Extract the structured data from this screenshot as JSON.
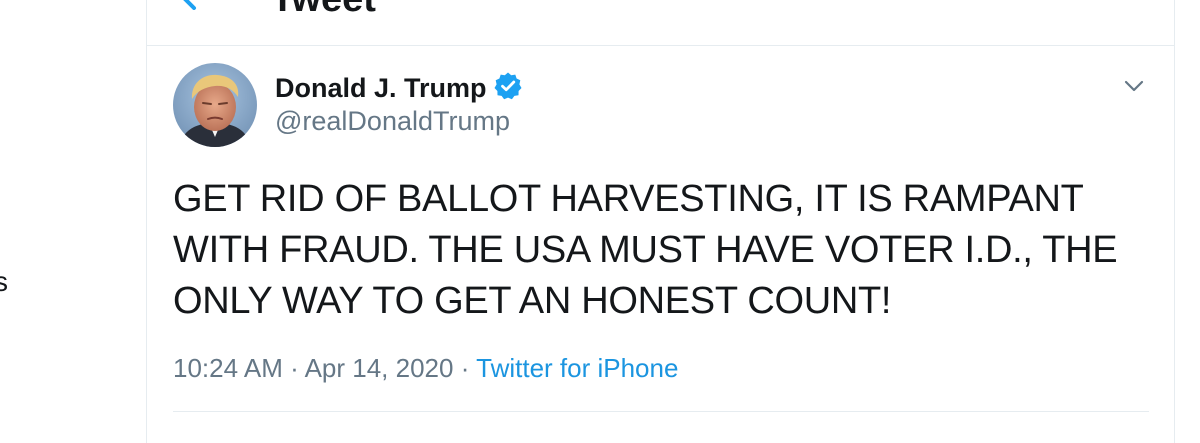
{
  "left_rail": {
    "fragment": "s"
  },
  "header": {
    "title": "Tweet",
    "back_icon": "back-arrow-icon"
  },
  "tweet": {
    "author": {
      "display_name": "Donald J. Trump",
      "handle": "@realDonaldTrump",
      "verified": true,
      "verified_icon": "verified-badge-icon"
    },
    "text": "GET RID OF BALLOT HARVESTING, IT IS RAMPANT WITH FRAUD. THE USA MUST HAVE VOTER I.D., THE ONLY WAY TO GET AN HONEST COUNT!",
    "time": "10:24 AM",
    "separator": "·",
    "date": "Apr 14, 2020",
    "source": "Twitter for iPhone",
    "menu_icon": "chevron-down-icon"
  },
  "colors": {
    "text_primary": "#14171a",
    "text_secondary": "#657786",
    "accent": "#1da1f2",
    "link": "#1b95e0",
    "divider": "#e6ecf0"
  }
}
